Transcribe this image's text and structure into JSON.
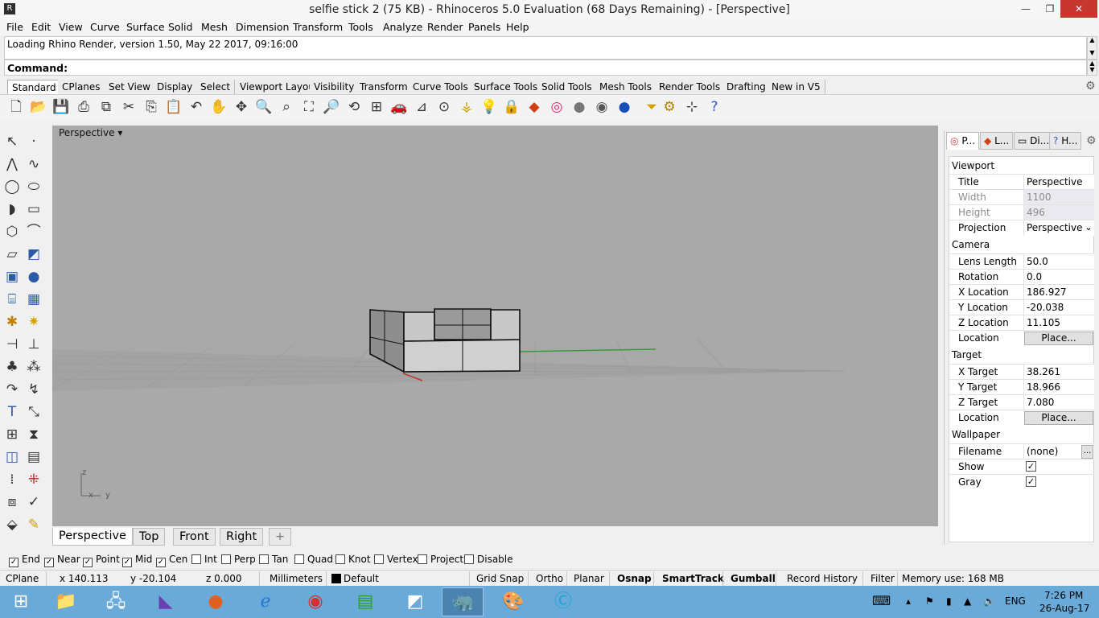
{
  "window": {
    "title": "selfie stick 2 (75 KB) - Rhinoceros 5.0 Evaluation (68 Days Remaining) - [Perspective]",
    "controls": {
      "minimize": "—",
      "maximize": "❐",
      "close": "✕"
    }
  },
  "menu": [
    "File",
    "Edit",
    "View",
    "Curve",
    "Surface",
    "Solid",
    "Mesh",
    "Dimension",
    "Transform",
    "Tools",
    "Analyze",
    "Render",
    "Panels",
    "Help"
  ],
  "command": {
    "history": "Loading Rhino Render, version 1.50, May 22 2017, 09:16:00",
    "prompt": "Command:"
  },
  "toolbar_tabs": [
    "Standard",
    "CPlanes",
    "Set View",
    "Display",
    "Select",
    "Viewport Layout",
    "Visibility",
    "Transform",
    "Curve Tools",
    "Surface Tools",
    "Solid Tools",
    "Mesh Tools",
    "Render Tools",
    "Drafting",
    "New in V5"
  ],
  "toolbar_icons": [
    "new-file-icon",
    "open-icon",
    "save-icon",
    "print-icon",
    "import-icon",
    "cut-icon",
    "copy-icon",
    "paste-icon",
    "undo-icon",
    "pan-icon",
    "rotate-view-icon",
    "zoom-dynamic-icon",
    "zoom-window-icon",
    "zoom-extents-icon",
    "zoom-selected-icon",
    "rotate-view-icon",
    "four-views-icon",
    "car-icon",
    "cplane-icon",
    "circle-icon",
    "point-icon",
    "light-icon",
    "lock-icon",
    "layer-icon",
    "color-wheel-icon",
    "sphere-icon",
    "sphere-shaded-icon",
    "render-sphere-icon",
    "filter-icon",
    "options-gear-icon",
    "snap-grid-icon",
    "help-icon"
  ],
  "viewport": {
    "label": "Perspective",
    "axis": {
      "z": "z",
      "x": "x",
      "y": "y"
    }
  },
  "viewport_tabs": [
    "Perspective",
    "Top",
    "Front",
    "Right",
    "+"
  ],
  "panel": {
    "tabs": [
      "P...",
      "L...",
      "Di...",
      "H..."
    ],
    "sections": {
      "viewport": "Viewport",
      "camera": "Camera",
      "target": "Target",
      "wallpaper": "Wallpaper"
    },
    "viewport_props": [
      {
        "key": "Title",
        "value": "Perspective"
      },
      {
        "key": "Width",
        "value": "1100"
      },
      {
        "key": "Height",
        "value": "496"
      },
      {
        "key": "Projection",
        "value": "Perspective"
      }
    ],
    "camera_props": [
      {
        "key": "Lens Length",
        "value": "50.0"
      },
      {
        "key": "Rotation",
        "value": "0.0"
      },
      {
        "key": "X Location",
        "value": "186.927"
      },
      {
        "key": "Y Location",
        "value": "-20.038"
      },
      {
        "key": "Z Location",
        "value": "11.105"
      },
      {
        "key": "Location",
        "value": "Place..."
      }
    ],
    "target_props": [
      {
        "key": "X Target",
        "value": "38.261"
      },
      {
        "key": "Y Target",
        "value": "18.966"
      },
      {
        "key": "Z Target",
        "value": "7.080"
      },
      {
        "key": "Location",
        "value": "Place..."
      }
    ],
    "wallpaper_props": [
      {
        "key": "Filename",
        "value": "(none)",
        "button": "..."
      },
      {
        "key": "Show",
        "checked": true
      },
      {
        "key": "Gray",
        "checked": true
      }
    ]
  },
  "osnaps": [
    {
      "label": "End",
      "checked": true
    },
    {
      "label": "Near",
      "checked": true
    },
    {
      "label": "Point",
      "checked": true
    },
    {
      "label": "Mid",
      "checked": true
    },
    {
      "label": "Cen",
      "checked": true
    },
    {
      "label": "Int",
      "checked": false
    },
    {
      "label": "Perp",
      "checked": false
    },
    {
      "label": "Tan",
      "checked": false
    },
    {
      "label": "Quad",
      "checked": false
    },
    {
      "label": "Knot",
      "checked": false
    },
    {
      "label": "Vertex",
      "checked": false
    },
    {
      "label": "Project",
      "checked": false
    },
    {
      "label": "Disable",
      "checked": false
    }
  ],
  "status": {
    "cplane": "CPlane",
    "x": "x 140.113",
    "y": "y -20.104",
    "z": "z 0.000",
    "units": "Millimeters",
    "layer": "Default",
    "grid_snap": "Grid Snap",
    "ortho": "Ortho",
    "planar": "Planar",
    "osnap": "Osnap",
    "smarttrack": "SmartTrack",
    "gumball": "Gumball",
    "record_history": "Record History",
    "filter": "Filter",
    "memory": "Memory use: 168 MB"
  },
  "taskbar": {
    "apps": [
      "start-icon",
      "file-explorer-icon",
      "network-icon",
      "visual-studio-icon",
      "firefox-icon",
      "internet-explorer-icon",
      "chrome-icon",
      "store-icon",
      "app-icon",
      "rhino-icon",
      "paint-icon",
      "ccleaner-icon"
    ],
    "language": "ENG",
    "time": "7:26 PM",
    "date": "26-Aug-17"
  },
  "colors": {
    "viewport_bg": "#a9a9a9",
    "taskbar": "#6aaad8",
    "close": "#c7372f"
  }
}
